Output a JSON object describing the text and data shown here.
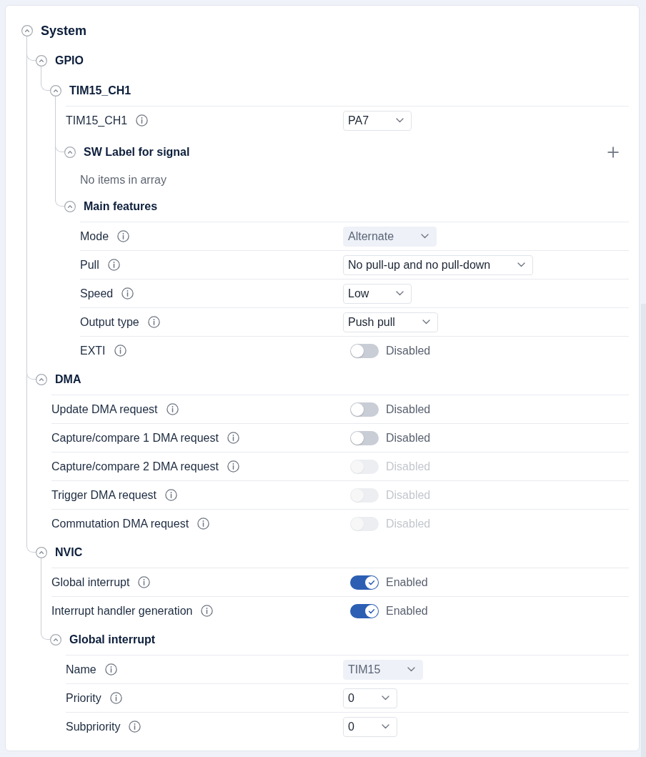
{
  "panel": {
    "title": "System",
    "expanded": true,
    "children": [
      {
        "kind": "group",
        "title": "GPIO",
        "expanded": true,
        "children": [
          {
            "kind": "group",
            "title": "TIM15_CH1",
            "expanded": true,
            "children": [
              {
                "kind": "select",
                "label": "TIM15_CH1",
                "value": "PA7",
                "disabled": false
              },
              {
                "kind": "group",
                "title": "SW Label for signal",
                "expanded": true,
                "addable": true,
                "children": [
                  {
                    "kind": "empty",
                    "text": "No items in array"
                  }
                ]
              },
              {
                "kind": "group",
                "title": "Main features",
                "expanded": true,
                "children": [
                  {
                    "kind": "select",
                    "label": "Mode",
                    "value": "Alternate",
                    "disabled": true
                  },
                  {
                    "kind": "select",
                    "label": "Pull",
                    "value": "No pull-up and no pull-down",
                    "disabled": false
                  },
                  {
                    "kind": "select",
                    "label": "Speed",
                    "value": "Low",
                    "disabled": false
                  },
                  {
                    "kind": "select",
                    "label": "Output type",
                    "value": "Push pull",
                    "disabled": false
                  },
                  {
                    "kind": "toggle",
                    "label": "EXTI",
                    "on": false,
                    "disabled": false,
                    "status": "Disabled"
                  }
                ]
              }
            ]
          }
        ]
      },
      {
        "kind": "group",
        "title": "DMA",
        "expanded": true,
        "children": [
          {
            "kind": "toggle",
            "label": "Update DMA request",
            "on": false,
            "disabled": false,
            "status": "Disabled"
          },
          {
            "kind": "toggle",
            "label": "Capture/compare 1 DMA request",
            "on": false,
            "disabled": false,
            "status": "Disabled"
          },
          {
            "kind": "toggle",
            "label": "Capture/compare 2 DMA request",
            "on": false,
            "disabled": true,
            "status": "Disabled"
          },
          {
            "kind": "toggle",
            "label": "Trigger DMA request",
            "on": false,
            "disabled": true,
            "status": "Disabled"
          },
          {
            "kind": "toggle",
            "label": "Commutation DMA request",
            "on": false,
            "disabled": true,
            "status": "Disabled"
          }
        ]
      },
      {
        "kind": "group",
        "title": "NVIC",
        "expanded": true,
        "children": [
          {
            "kind": "toggle",
            "label": "Global interrupt",
            "on": true,
            "disabled": false,
            "status": "Enabled"
          },
          {
            "kind": "toggle",
            "label": "Interrupt handler generation",
            "on": true,
            "disabled": false,
            "status": "Enabled"
          },
          {
            "kind": "group",
            "title": "Global interrupt",
            "expanded": true,
            "children": [
              {
                "kind": "select",
                "label": "Name",
                "value": "TIM15",
                "disabled": true
              },
              {
                "kind": "select",
                "label": "Priority",
                "value": "0",
                "disabled": false
              },
              {
                "kind": "select",
                "label": "Subpriority",
                "value": "0",
                "disabled": false
              }
            ]
          }
        ]
      }
    ]
  }
}
